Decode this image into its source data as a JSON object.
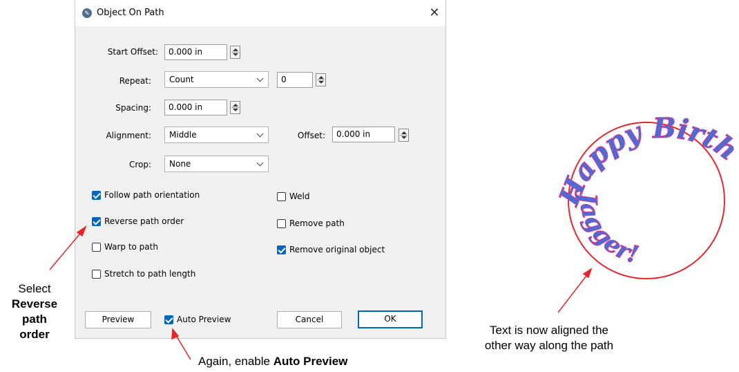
{
  "dialog": {
    "title": "Object On Path",
    "close_glyph": "✕",
    "start_offset": {
      "label": "Start Offset:",
      "value": "0.000 in"
    },
    "repeat": {
      "label": "Repeat:",
      "value": "Count",
      "count": "0"
    },
    "spacing": {
      "label": "Spacing:",
      "value": "0.000 in"
    },
    "alignment": {
      "label": "Alignment:",
      "value": "Middle"
    },
    "offset": {
      "label": "Offset:",
      "value": "0.000 in"
    },
    "crop": {
      "label": "Crop:",
      "value": "None"
    },
    "options_left": [
      {
        "label": "Follow path orientation",
        "checked": true
      },
      {
        "label": "Reverse path order",
        "checked": true
      },
      {
        "label": "Warp to path",
        "checked": false
      },
      {
        "label": "Stretch to path length",
        "checked": false
      }
    ],
    "options_right": [
      {
        "label": "Weld",
        "checked": false
      },
      {
        "label": "Remove path",
        "checked": false
      },
      {
        "label": "Remove original object",
        "checked": true
      }
    ],
    "buttons": {
      "preview": "Preview",
      "auto_preview": "Auto Preview",
      "cancel": "Cancel",
      "ok": "OK"
    }
  },
  "annotations": {
    "select_line1": "Select",
    "select_bold1": "Reverse",
    "select_bold2": "path",
    "select_bold3": "order",
    "again_prefix": "Again, enable ",
    "again_bold": "Auto Preview",
    "result_line1": "Text is now aligned the",
    "result_line2": "other way along the path"
  },
  "preview_art": {
    "arc_text": "Happy Birthday",
    "inner_text": "Jagger!"
  },
  "colors": {
    "accent": "#0067c0",
    "path_circle": "#e8262a",
    "text_fill": "#4a6bd8",
    "arrow": "#e8262a"
  }
}
